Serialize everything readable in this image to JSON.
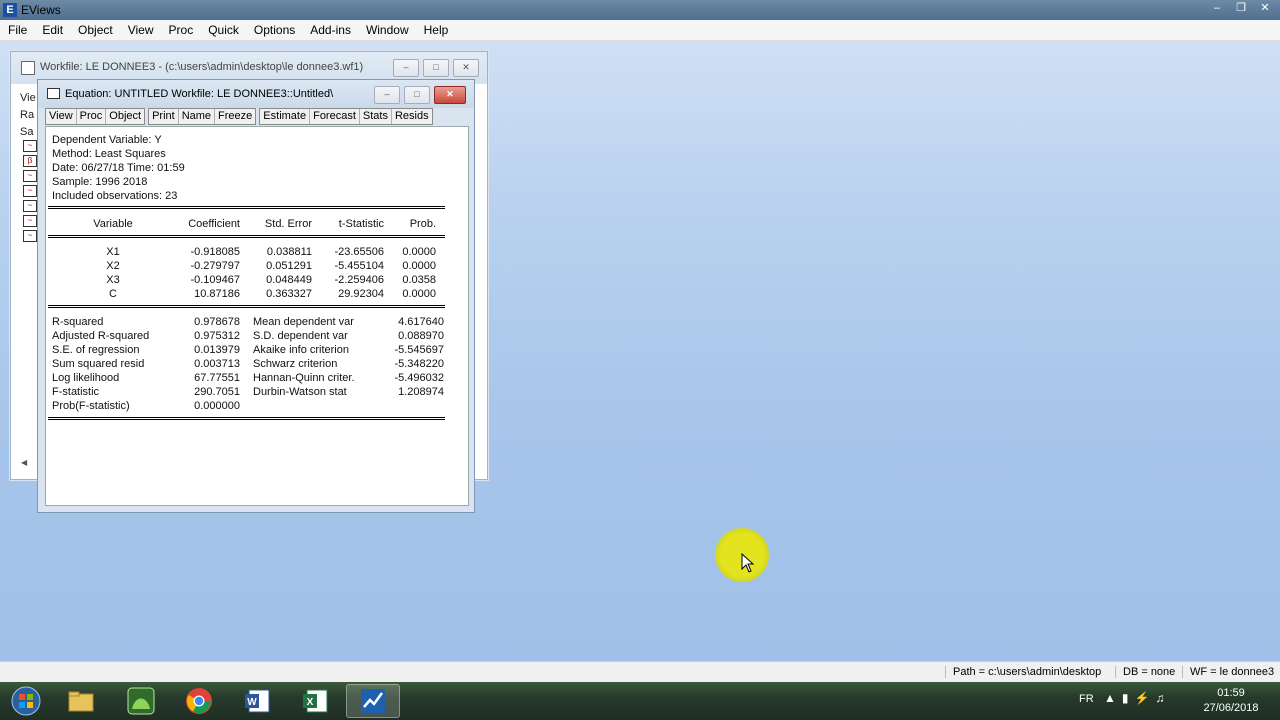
{
  "app": {
    "title": "EViews",
    "menu": [
      "File",
      "Edit",
      "Object",
      "View",
      "Proc",
      "Quick",
      "Options",
      "Add-ins",
      "Window",
      "Help"
    ]
  },
  "workfile_window": {
    "title": "Workfile: LE DONNEE3 - (c:\\users\\admin\\desktop\\le donnee3.wf1)",
    "side_labels": [
      "Vie",
      "Ra",
      "Sa"
    ]
  },
  "equation_window": {
    "title": "Equation: UNTITLED   Workfile: LE DONNEE3::Untitled\\",
    "toolbar": {
      "group1": [
        "View",
        "Proc",
        "Object"
      ],
      "group2": [
        "Print",
        "Name",
        "Freeze"
      ],
      "group3": [
        "Estimate",
        "Forecast",
        "Stats",
        "Resids"
      ]
    },
    "header": [
      "Dependent Variable: Y",
      "Method: Least Squares",
      "Date: 06/27/18   Time: 01:59",
      "Sample: 1996 2018",
      "Included observations: 23"
    ],
    "coef_table": {
      "columns": [
        "Variable",
        "Coefficient",
        "Std. Error",
        "t-Statistic",
        "Prob."
      ],
      "rows": [
        [
          "X1",
          "-0.918085",
          "0.038811",
          "-23.65506",
          "0.0000"
        ],
        [
          "X2",
          "-0.279797",
          "0.051291",
          "-5.455104",
          "0.0000"
        ],
        [
          "X3",
          "-0.109467",
          "0.048449",
          "-2.259406",
          "0.0358"
        ],
        [
          "C",
          "10.87186",
          "0.363327",
          "29.92304",
          "0.0000"
        ]
      ]
    },
    "stats_table": [
      [
        "R-squared",
        "0.978678",
        "Mean dependent var",
        "4.617640"
      ],
      [
        "Adjusted R-squared",
        "0.975312",
        "S.D. dependent var",
        "0.088970"
      ],
      [
        "S.E. of regression",
        "0.013979",
        "Akaike info criterion",
        "-5.545697"
      ],
      [
        "Sum squared resid",
        "0.003713",
        "Schwarz criterion",
        "-5.348220"
      ],
      [
        "Log likelihood",
        "67.77551",
        "Hannan-Quinn criter.",
        "-5.496032"
      ],
      [
        "F-statistic",
        "290.7051",
        "Durbin-Watson stat",
        "1.208974"
      ],
      [
        "Prob(F-statistic)",
        "0.000000",
        "",
        ""
      ]
    ]
  },
  "statusbar": {
    "path": "Path = c:\\users\\admin\\desktop",
    "db": "DB = none",
    "wf": "WF = le donnee3"
  },
  "taskbar": {
    "lang": "FR",
    "time": "01:59",
    "date": "27/06/2018"
  },
  "colors": {
    "desktop": "#a8c6ea",
    "cursor_highlight": "#e4e41e",
    "close_button": "#c9473a"
  }
}
